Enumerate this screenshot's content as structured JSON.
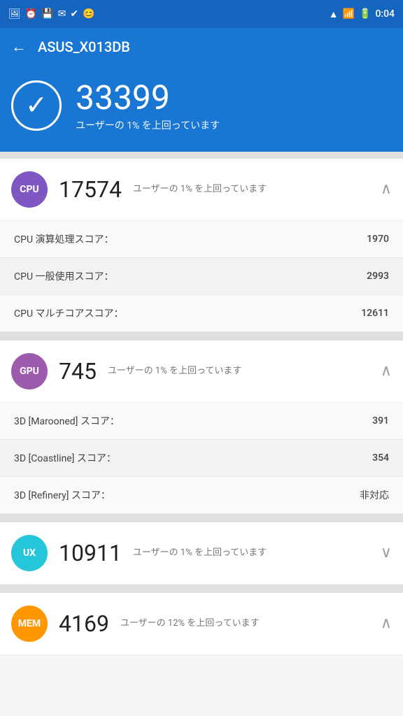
{
  "statusBar": {
    "time": "0:04",
    "icons_left": [
      "photo-icon",
      "clock-icon",
      "sd-icon",
      "email-icon",
      "check-icon",
      "face-icon"
    ],
    "icons_right": [
      "wifi-icon",
      "signal-icon",
      "battery-icon"
    ]
  },
  "header": {
    "back_label": "←",
    "title": "ASUS_X013DB"
  },
  "scoreSection": {
    "total_score": "33399",
    "description": "ユーザーの 1% を上回っています"
  },
  "benchmarks": [
    {
      "id": "cpu",
      "badge_label": "CPU",
      "badge_class": "badge-cpu",
      "score": "17574",
      "description": "ユーザーの 1% を上回っています",
      "chevron": "∧",
      "details": [
        {
          "label": "CPU 演算処理スコア：",
          "value": "1970"
        },
        {
          "label": "CPU 一般使用スコア：",
          "value": "2993"
        },
        {
          "label": "CPU マルチコアスコア：",
          "value": "12611"
        }
      ]
    },
    {
      "id": "gpu",
      "badge_label": "GPU",
      "badge_class": "badge-gpu",
      "score": "745",
      "description": "ユーザーの 1% を上回っています",
      "chevron": "∧",
      "details": [
        {
          "label": "3D [Marooned] スコア：",
          "value": "391"
        },
        {
          "label": "3D [Coastline] スコア：",
          "value": "354"
        },
        {
          "label": "3D [Refinery] スコア：",
          "value": "非対応"
        }
      ]
    },
    {
      "id": "ux",
      "badge_label": "UX",
      "badge_class": "badge-ux",
      "score": "10911",
      "description": "ユーザーの 1% を上回っています",
      "chevron": "∨",
      "details": []
    },
    {
      "id": "mem",
      "badge_label": "MEM",
      "badge_class": "badge-mem",
      "score": "4169",
      "description": "ユーザーの 12% を上回っています",
      "chevron": "∧",
      "details": []
    }
  ]
}
